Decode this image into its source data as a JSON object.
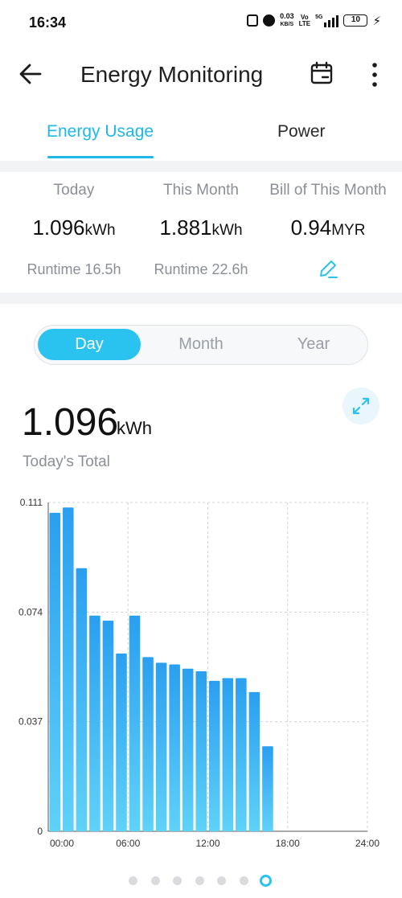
{
  "status_bar": {
    "time": "16:34",
    "speed_value": "0.03",
    "speed_unit": "KB/S",
    "volte_top": "Vo",
    "volte_bottom": "LTE",
    "network": "5G",
    "battery": "10"
  },
  "app_bar": {
    "title": "Energy Monitoring"
  },
  "tabs": [
    {
      "label": "Energy Usage",
      "active": true
    },
    {
      "label": "Power",
      "active": false
    }
  ],
  "summary": {
    "today": {
      "label": "Today",
      "value": "1.096",
      "unit": "kWh",
      "runtime": "Runtime 16.5h"
    },
    "month": {
      "label": "This Month",
      "value": "1.881",
      "unit": "kWh",
      "runtime": "Runtime 22.6h"
    },
    "bill": {
      "label": "Bill of This Month",
      "value": "0.94",
      "unit": "MYR"
    }
  },
  "period_selector": {
    "options": [
      "Day",
      "Month",
      "Year"
    ],
    "selected": "Day"
  },
  "total": {
    "value": "1.096",
    "unit": "kWh",
    "caption": "Today's Total"
  },
  "colors": {
    "accent": "#2ac3f0",
    "bar_top": "#2a9ff0",
    "bar_bottom": "#5fd2f8"
  },
  "chart_data": {
    "type": "bar",
    "x_ticks": [
      "00:00",
      "06:00",
      "12:00",
      "18:00",
      "24:00"
    ],
    "y_ticks": [
      "0",
      "0.037",
      "0.074",
      "0.111"
    ],
    "ylim": [
      0,
      0.111
    ],
    "xlim": [
      0,
      24
    ],
    "grid": true,
    "series": [
      {
        "x": [
          0,
          1,
          2,
          3,
          4,
          5,
          6,
          7,
          8,
          9,
          10,
          11,
          12,
          13,
          14,
          15,
          16
        ],
        "values": [
          0.1075,
          0.1093,
          0.0888,
          0.0728,
          0.0711,
          0.06,
          0.0728,
          0.0588,
          0.0569,
          0.0563,
          0.0549,
          0.054,
          0.0508,
          0.0517,
          0.0517,
          0.047,
          0.0287
        ]
      }
    ]
  },
  "pager": {
    "count": 7,
    "active_index": 6
  }
}
